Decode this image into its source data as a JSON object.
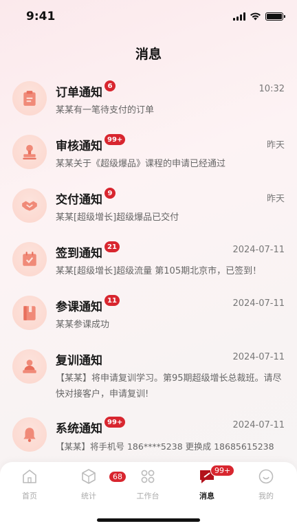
{
  "status_bar": {
    "time": "9:41"
  },
  "page": {
    "title": "消息"
  },
  "messages": [
    {
      "title": "订单通知",
      "badge": "6",
      "time": "10:32",
      "text": "某某有一笔待支付的订单",
      "icon": "order-icon"
    },
    {
      "title": "审核通知",
      "badge": "99+",
      "time": "昨天",
      "text": "某某关于《超级爆品》课程的申请已经通过",
      "icon": "stamp-icon"
    },
    {
      "title": "交付通知",
      "badge": "9",
      "time": "昨天",
      "text": "某某[超级增长]超级爆品已交付",
      "icon": "handshake-icon"
    },
    {
      "title": "签到通知",
      "badge": "21",
      "time": "2024-07-11",
      "text": "某某[超级增长]超级流量 第105期北京市，已签到！",
      "icon": "calendar-check-icon"
    },
    {
      "title": "参课通知",
      "badge": "11",
      "time": "2024-07-11",
      "text": "某某参课成功",
      "icon": "book-icon"
    },
    {
      "title": "复训通知",
      "badge": "",
      "time": "2024-07-11",
      "text": "【某某】将申请复训学习。第95期超级增长总裁班。请尽快对接客户，申请复训!",
      "icon": "person-desk-icon"
    },
    {
      "title": "系统通知",
      "badge": "99+",
      "time": "2024-07-11",
      "text": "【某某】将手机号 186****5238 更换成 18685615238",
      "icon": "bell-icon"
    }
  ],
  "tab_bar": {
    "tabs": [
      {
        "label": "首页",
        "icon": "home-icon"
      },
      {
        "label": "统计",
        "icon": "cube-icon",
        "badge": "68"
      },
      {
        "label": "工作台",
        "icon": "grid-icon"
      },
      {
        "label": "消息",
        "icon": "message-icon",
        "badge": "99+",
        "active": true
      },
      {
        "label": "我的",
        "icon": "smile-icon"
      }
    ]
  },
  "colors": {
    "accent": "#d8262f",
    "icon_tint": "#f08a78"
  }
}
